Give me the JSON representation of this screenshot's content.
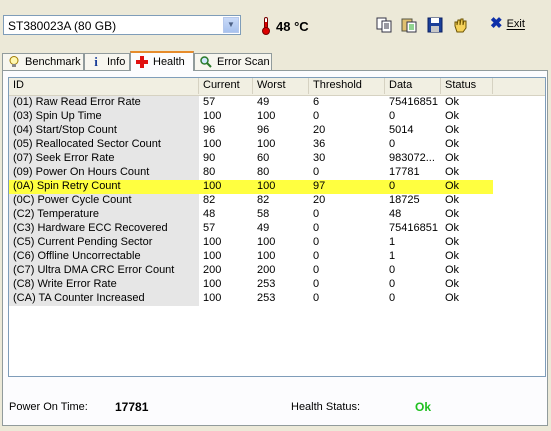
{
  "toolbar": {
    "drive": "ST380023A (80 GB)",
    "temperature": "48 °C",
    "exit_label": "Exit"
  },
  "tabs": [
    {
      "label": "Benchmark",
      "icon": "lightbulb-icon"
    },
    {
      "label": "Info",
      "icon": "info-icon"
    },
    {
      "label": "Health",
      "icon": "red-cross-icon",
      "active": true
    },
    {
      "label": "Error Scan",
      "icon": "magnifier-icon"
    }
  ],
  "table": {
    "columns": [
      "ID",
      "Current",
      "Worst",
      "Threshold",
      "Data",
      "Status"
    ],
    "rows": [
      {
        "id": "(01) Raw Read Error Rate",
        "current": "57",
        "worst": "49",
        "threshold": "6",
        "data": "75416851",
        "status": "Ok"
      },
      {
        "id": "(03) Spin Up Time",
        "current": "100",
        "worst": "100",
        "threshold": "0",
        "data": "0",
        "status": "Ok"
      },
      {
        "id": "(04) Start/Stop Count",
        "current": "96",
        "worst": "96",
        "threshold": "20",
        "data": "5014",
        "status": "Ok"
      },
      {
        "id": "(05) Reallocated Sector Count",
        "current": "100",
        "worst": "100",
        "threshold": "36",
        "data": "0",
        "status": "Ok"
      },
      {
        "id": "(07) Seek Error Rate",
        "current": "90",
        "worst": "60",
        "threshold": "30",
        "data": "983072...",
        "status": "Ok"
      },
      {
        "id": "(09) Power On Hours Count",
        "current": "80",
        "worst": "80",
        "threshold": "0",
        "data": "17781",
        "status": "Ok"
      },
      {
        "id": "(0A) Spin Retry Count",
        "current": "100",
        "worst": "100",
        "threshold": "97",
        "data": "0",
        "status": "Ok",
        "highlight": true
      },
      {
        "id": "(0C) Power Cycle Count",
        "current": "82",
        "worst": "82",
        "threshold": "20",
        "data": "18725",
        "status": "Ok"
      },
      {
        "id": "(C2) Temperature",
        "current": "48",
        "worst": "58",
        "threshold": "0",
        "data": "48",
        "status": "Ok"
      },
      {
        "id": "(C3) Hardware ECC Recovered",
        "current": "57",
        "worst": "49",
        "threshold": "0",
        "data": "75416851",
        "status": "Ok"
      },
      {
        "id": "(C5) Current Pending Sector",
        "current": "100",
        "worst": "100",
        "threshold": "0",
        "data": "1",
        "status": "Ok"
      },
      {
        "id": "(C6) Offline Uncorrectable",
        "current": "100",
        "worst": "100",
        "threshold": "0",
        "data": "1",
        "status": "Ok"
      },
      {
        "id": "(C7) Ultra DMA CRC Error Count",
        "current": "200",
        "worst": "200",
        "threshold": "0",
        "data": "0",
        "status": "Ok"
      },
      {
        "id": "(C8) Write Error Rate",
        "current": "100",
        "worst": "253",
        "threshold": "0",
        "data": "0",
        "status": "Ok"
      },
      {
        "id": "(CA) TA Counter Increased",
        "current": "100",
        "worst": "253",
        "threshold": "0",
        "data": "0",
        "status": "Ok"
      }
    ]
  },
  "footer": {
    "power_on_label": "Power On Time:",
    "power_on_value": "17781",
    "health_label": "Health Status:",
    "health_value": "Ok"
  },
  "colors": {
    "highlight_row": "#ffff40",
    "health_ok": "#20c020",
    "active_tab_accent": "#e68b2c"
  }
}
